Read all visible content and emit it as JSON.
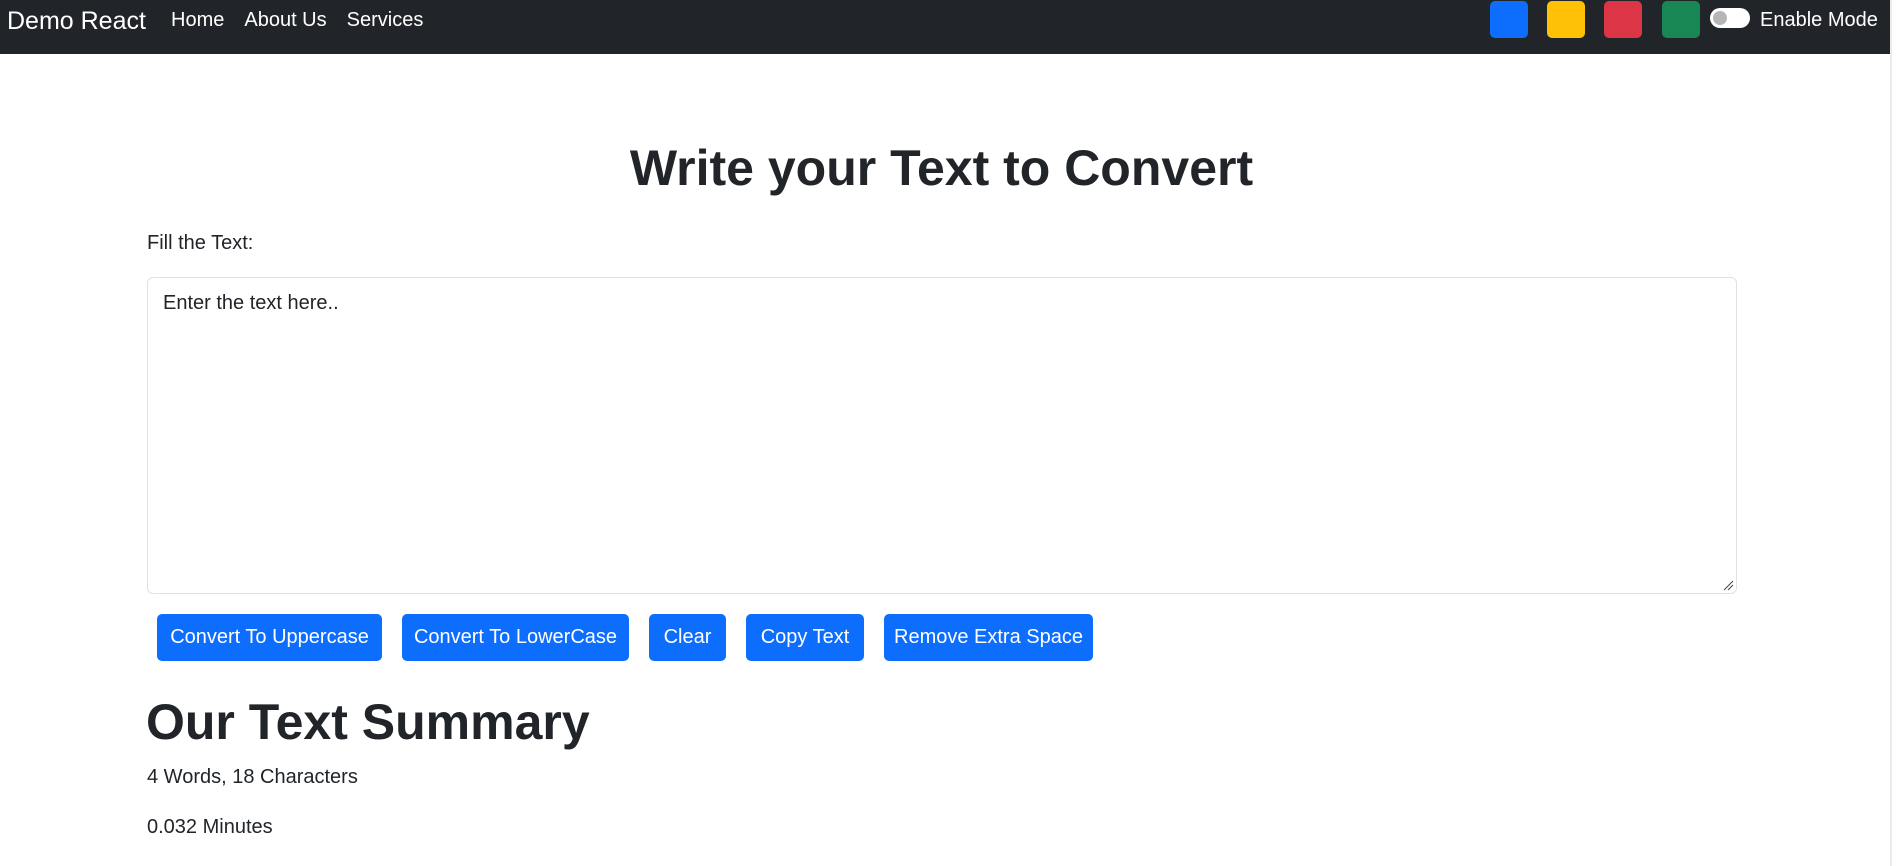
{
  "navbar": {
    "brand": "Demo React",
    "links": [
      "Home",
      "About Us",
      "Services"
    ],
    "swatches": [
      {
        "name": "blue",
        "color": "#0d6efd"
      },
      {
        "name": "yellow",
        "color": "#ffc107"
      },
      {
        "name": "red",
        "color": "#dc3545"
      },
      {
        "name": "green",
        "color": "#198754"
      }
    ],
    "toggle_label": "Enable Mode"
  },
  "main": {
    "title": "Write your Text to Convert",
    "field_label": "Fill the Text:",
    "textarea_placeholder": "Enter the text here..",
    "buttons": [
      "Convert To Uppercase",
      "Convert To LowerCase",
      "Clear",
      "Copy Text",
      "Remove Extra Space"
    ]
  },
  "summary": {
    "title": "Our Text Summary",
    "counts": "4 Words, 18 Characters",
    "read_time": "0.032 Minutes"
  },
  "colors": {
    "navbar_bg": "#212529",
    "primary": "#0d6efd"
  }
}
